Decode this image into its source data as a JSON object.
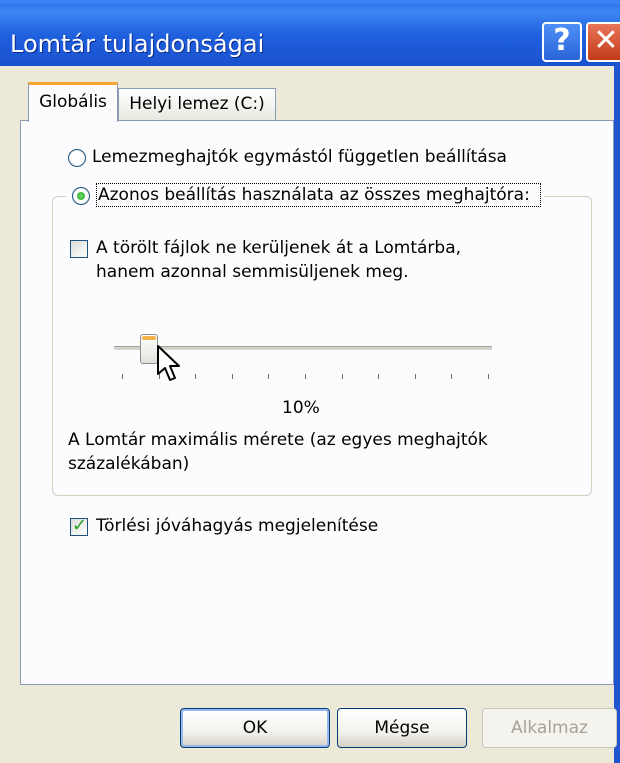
{
  "window": {
    "title": "Lomtár tulajdonságai",
    "help_glyph": "?",
    "close_glyph": "✕"
  },
  "tabs": [
    {
      "label": "Globális",
      "selected": true
    },
    {
      "label": "Helyi lemez (C:)",
      "selected": false
    }
  ],
  "options": {
    "independent_radio": {
      "label": "Lemezmeghajtók egymástól független beállítása",
      "checked": false
    },
    "same_radio": {
      "label": "Azonos beállítás használata az összes meghajtóra:",
      "checked": true
    },
    "delete_immediately": {
      "label_line1": "A törölt fájlok ne kerüljenek át a Lomtárba,",
      "label_line2": "hanem azonnal semmisüljenek meg.",
      "checked": false
    },
    "size_slider": {
      "value_text": "10%",
      "value": 10
    },
    "size_caption_line1": "A Lomtár maximális mérete (az egyes meghajtók",
    "size_caption_line2": "százalékában)",
    "confirm_delete": {
      "label": "Törlési jóváhagyás megjelenítése",
      "checked": true
    }
  },
  "buttons": {
    "ok": "OK",
    "cancel": "Mégse",
    "apply": "Alkalmaz"
  },
  "colors": {
    "titlebar": "#1e5fdd",
    "tab_highlight": "#f7a532",
    "check": "#21a121"
  },
  "icons": {
    "help": "help-icon",
    "close": "close-icon",
    "cursor": "mouse-pointer-icon"
  }
}
